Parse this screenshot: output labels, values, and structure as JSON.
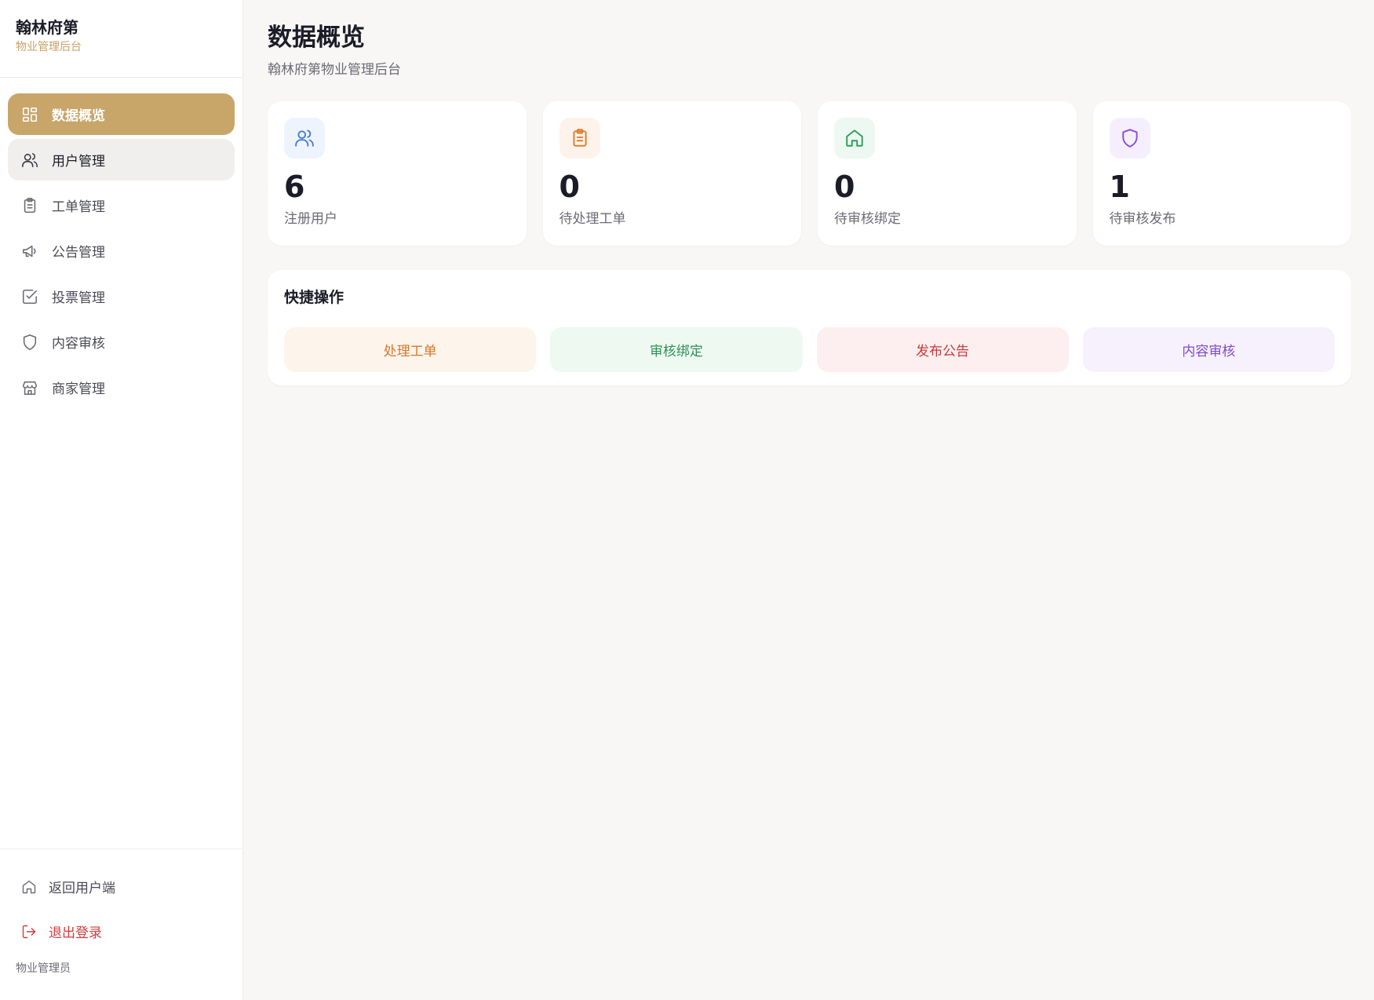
{
  "brand": {
    "title": "翰林府第",
    "subtitle": "物业管理后台"
  },
  "sidebar": {
    "items": [
      {
        "label": "数据概览",
        "icon": "dashboard-icon"
      },
      {
        "label": "用户管理",
        "icon": "users-icon"
      },
      {
        "label": "工单管理",
        "icon": "clipboard-icon"
      },
      {
        "label": "公告管理",
        "icon": "megaphone-icon"
      },
      {
        "label": "投票管理",
        "icon": "checkbox-icon"
      },
      {
        "label": "内容审核",
        "icon": "shield-icon"
      },
      {
        "label": "商家管理",
        "icon": "store-icon"
      }
    ],
    "active_index": 0,
    "hover_index": 1,
    "back_label": "返回用户端",
    "logout_label": "退出登录",
    "role": "物业管理员"
  },
  "header": {
    "title": "数据概览",
    "subtitle": "翰林府第物业管理后台"
  },
  "stats": [
    {
      "value": "6",
      "label": "注册用户",
      "icon": "users-icon",
      "color": "#4a7fd4",
      "bg": "#eef4fd"
    },
    {
      "value": "0",
      "label": "待处理工单",
      "icon": "clipboard-icon",
      "color": "#e07d2e",
      "bg": "#fdf3ea"
    },
    {
      "value": "0",
      "label": "待审核绑定",
      "icon": "home-icon",
      "color": "#2f9e5e",
      "bg": "#ecf8f1"
    },
    {
      "value": "1",
      "label": "待审核发布",
      "icon": "shield-icon",
      "color": "#8a4fd6",
      "bg": "#f5effd"
    }
  ],
  "quick": {
    "title": "快捷操作",
    "actions": [
      {
        "label": "处理工单",
        "color": "#d4782a",
        "bg": "#fdf4ec"
      },
      {
        "label": "审核绑定",
        "color": "#2f8f57",
        "bg": "#eef9f2"
      },
      {
        "label": "发布公告",
        "color": "#c53a3a",
        "bg": "#fdeff0"
      },
      {
        "label": "内容审核",
        "color": "#7f4bc8",
        "bg": "#f6f1fd"
      }
    ]
  },
  "colors": {
    "accent": "#c8a569",
    "background": "#f8f7f6",
    "danger": "#d43b3b"
  }
}
